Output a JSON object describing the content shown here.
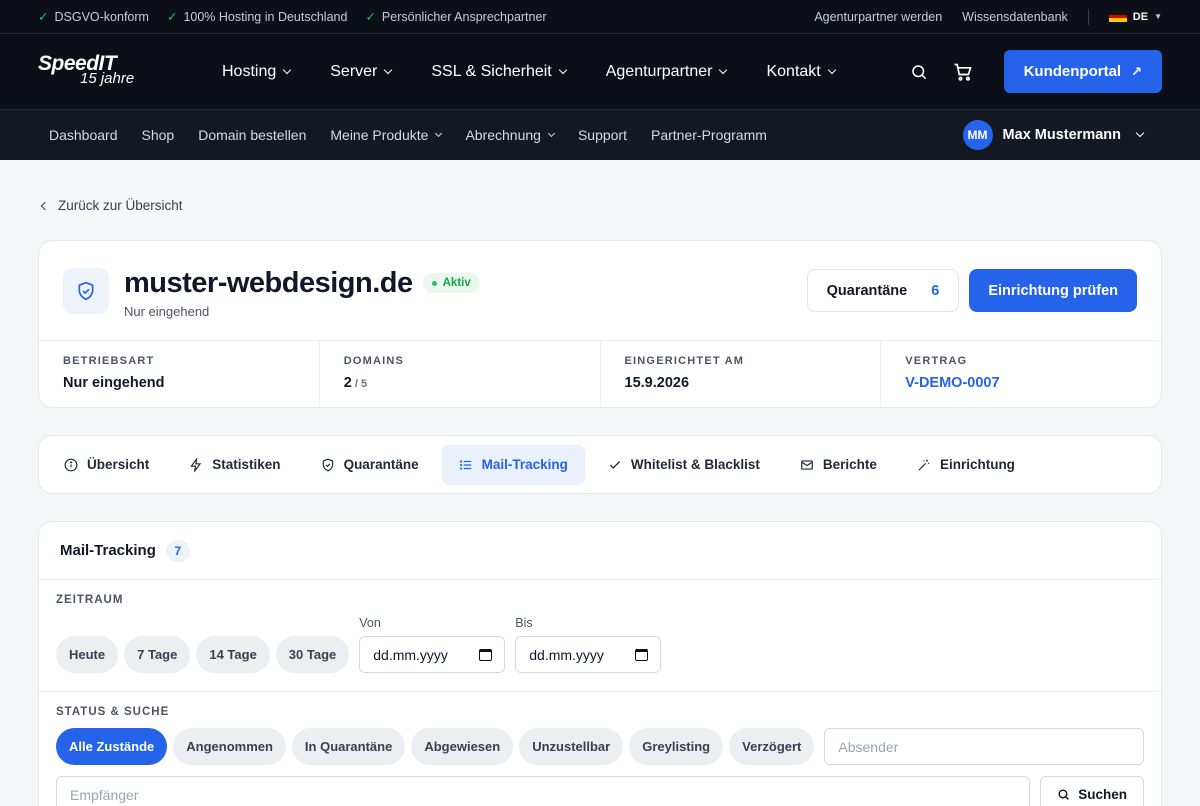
{
  "topbar": {
    "trust": [
      "DSGVO-konform",
      "100% Hosting in Deutschland",
      "Persönlicher Ansprechpartner"
    ],
    "links": [
      "Agenturpartner werden",
      "Wissensdatenbank"
    ],
    "lang": "DE"
  },
  "logo": {
    "brand": "SpeedIT",
    "tagline": "15 jahre"
  },
  "mainnav": {
    "items": [
      "Hosting",
      "Server",
      "SSL & Sicherheit",
      "Agenturpartner",
      "Kontakt"
    ],
    "portal_label": "Kundenportal"
  },
  "subnav": {
    "items": [
      "Dashboard",
      "Shop",
      "Domain bestellen",
      "Meine Produkte",
      "Abrechnung",
      "Support",
      "Partner-Programm"
    ],
    "user_initials": "MM",
    "user_name": "Max Mustermann"
  },
  "back_label": "Zurück zur Übersicht",
  "domain": {
    "name": "muster-webdesign.de",
    "status": "Aktiv",
    "mode_sub": "Nur eingehend",
    "quarantine_label": "Quarantäne",
    "quarantine_count": "6",
    "check_label": "Einrichtung prüfen",
    "stats": [
      {
        "label": "BETRIEBSART",
        "value": "Nur eingehend"
      },
      {
        "label": "DOMAINS",
        "value": "2",
        "suffix": " / 5"
      },
      {
        "label": "EINGERICHTET AM",
        "value": "15.9.2026"
      },
      {
        "label": "VERTRAG",
        "value": "V-DEMO-0007"
      }
    ]
  },
  "tabs": [
    "Übersicht",
    "Statistiken",
    "Quarantäne",
    "Mail-Tracking",
    "Whitelist & Blacklist",
    "Berichte",
    "Einrichtung"
  ],
  "tracking": {
    "title": "Mail-Tracking",
    "count": "7",
    "zeitraum_label": "ZEITRAUM",
    "ranges": [
      "Heute",
      "7 Tage",
      "14 Tage",
      "30 Tage"
    ],
    "from_label": "Von",
    "to_label": "Bis",
    "date_placeholder": "dd.mm.yyyy",
    "status_label": "STATUS & SUCHE",
    "statuses": [
      "Alle Zustände",
      "Angenommen",
      "In Quarantäne",
      "Abgewiesen",
      "Unzustellbar",
      "Greylisting",
      "Verzögert"
    ],
    "sender_placeholder": "Absender",
    "recipient_placeholder": "Empfänger",
    "search_label": "Suchen"
  }
}
